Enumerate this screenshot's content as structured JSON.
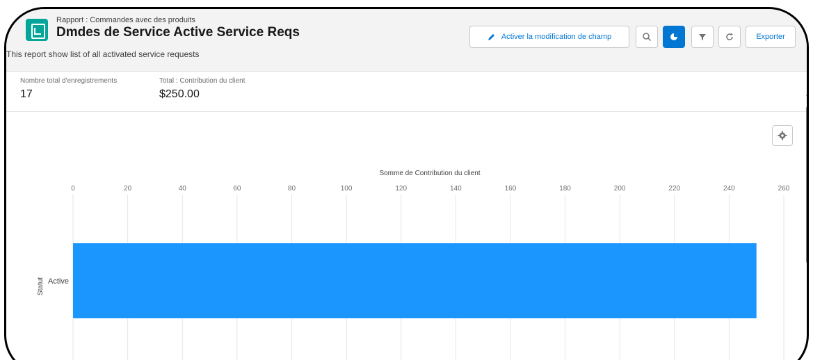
{
  "header": {
    "eyebrow": "Rapport : Commandes avec des produits",
    "title": "Dmdes de Service Active Service Reqs",
    "subtitle": "This report show list of all activated service requests",
    "edit_button": "Activer la modification de champ",
    "export_button": "Exporter"
  },
  "summary": {
    "count_label": "Nombre total d'enregistrements",
    "count_value": "17",
    "total_label": "Total : Contribution du client",
    "total_value": "$250.00"
  },
  "chart_data": {
    "type": "bar",
    "orientation": "horizontal",
    "title": "Somme de Contribution du client",
    "ylabel": "Statut",
    "categories": [
      "Active"
    ],
    "values": [
      250
    ],
    "xlim": [
      0,
      260
    ],
    "xticks": [
      0,
      20,
      40,
      60,
      80,
      100,
      120,
      140,
      160,
      180,
      200,
      220,
      240,
      260
    ],
    "grid": true,
    "bar_color": "#1b96ff"
  },
  "icons": {
    "report": "report-icon",
    "edit": "pencil-icon",
    "search": "search-icon",
    "chart": "chart-icon",
    "filter": "filter-icon",
    "refresh": "refresh-icon",
    "settings": "gear-icon"
  },
  "colors": {
    "accent": "#0176d3",
    "bar": "#1b96ff",
    "report_icon": "#06a59a"
  }
}
